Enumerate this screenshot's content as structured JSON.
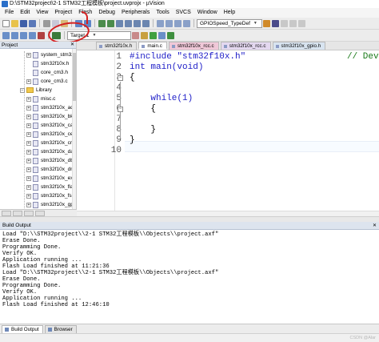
{
  "window": {
    "title": "D:\\STM32project\\2-1 STM32工程模板\\project.uvprojx - µVision"
  },
  "menu": [
    "File",
    "Edit",
    "View",
    "Project",
    "Flash",
    "Debug",
    "Peripherals",
    "Tools",
    "SVCS",
    "Window",
    "Help"
  ],
  "toolbar": {
    "find_combo_value": "GPIOSpeed_TypeDef",
    "target_combo_value": "Target 1"
  },
  "colors": {
    "annotation": "#d42020",
    "active_tab": "#ffffff",
    "editor_bg": "#ffffff",
    "keyword": "#2020c8",
    "comment": "#1a7a1a"
  },
  "project": {
    "header": "Project",
    "items": [
      {
        "label": "system_stm32",
        "kind": "file",
        "expanded": "+"
      },
      {
        "label": "stm32f10x.h",
        "kind": "file",
        "expanded": ""
      },
      {
        "label": "core_cm3.h",
        "kind": "file",
        "expanded": ""
      },
      {
        "label": "core_cm3.c",
        "kind": "file",
        "expanded": "+"
      },
      {
        "label": "Library",
        "kind": "folder",
        "expanded": "−"
      },
      {
        "label": "misc.c",
        "kind": "file",
        "expanded": "+"
      },
      {
        "label": "stm32f10x_adc",
        "kind": "file",
        "expanded": "+"
      },
      {
        "label": "stm32f10x_bkp",
        "kind": "file",
        "expanded": "+"
      },
      {
        "label": "stm32f10x_can",
        "kind": "file",
        "expanded": "+"
      },
      {
        "label": "stm32f10x_cec",
        "kind": "file",
        "expanded": "+"
      },
      {
        "label": "stm32f10x_crc",
        "kind": "file",
        "expanded": "+"
      },
      {
        "label": "stm32f10x_dac",
        "kind": "file",
        "expanded": "+"
      },
      {
        "label": "stm32f10x_dbg",
        "kind": "file",
        "expanded": "+"
      },
      {
        "label": "stm32f10x_dma",
        "kind": "file",
        "expanded": "+"
      },
      {
        "label": "stm32f10x_exti",
        "kind": "file",
        "expanded": "+"
      },
      {
        "label": "stm32f10x_flas",
        "kind": "file",
        "expanded": "+"
      },
      {
        "label": "stm32f10x_fsm",
        "kind": "file",
        "expanded": "+"
      },
      {
        "label": "stm32f10x_gpio",
        "kind": "file",
        "expanded": "+"
      },
      {
        "label": "stm32f10x_i2c",
        "kind": "file",
        "expanded": "+"
      }
    ]
  },
  "editor": {
    "tabs": [
      {
        "label": "stm32f10x.h",
        "bg": "#e6e6e6"
      },
      {
        "label": "main.c",
        "bg": "#ffffff"
      },
      {
        "label": "stm32f10x_rcc.c",
        "bg": "#f0c8d8"
      },
      {
        "label": "stm32f10x_rcc.c",
        "bg": "#e4d8f0"
      },
      {
        "label": "stm32f10x_gpio.h",
        "bg": "#d8e4f0"
      }
    ],
    "line_numbers": [
      "1",
      "2",
      "3",
      "4",
      "5",
      "6",
      "7",
      "8",
      "9",
      "10"
    ],
    "lines": [
      "#include \"stm32f10x.h\"",
      "int main(void)",
      "{",
      "",
      "    while(1)",
      "    {",
      "",
      "    }",
      "}",
      ""
    ],
    "line1_comment": "// Dev"
  },
  "build": {
    "header": "Build Output",
    "lines": [
      "Load \"D:\\\\STM32project\\\\2-1 STM32工程模板\\\\Objects\\\\project.axf\"",
      "Erase Done.",
      "Programming Done.",
      "Verify OK.",
      "Application running ...",
      "Flash Load finished at 11:21:36",
      "Load \"D:\\\\STM32project\\\\2-1 STM32工程模板\\\\Objects\\\\project.axf\"",
      "Erase Done.",
      "Programming Done.",
      "Verify OK.",
      "Application running ...",
      "Flash Load finished at 12:46:10"
    ],
    "tabs": [
      "Build Output",
      "Browser"
    ]
  },
  "status": {
    "watermark": "CSDN @Alar"
  }
}
